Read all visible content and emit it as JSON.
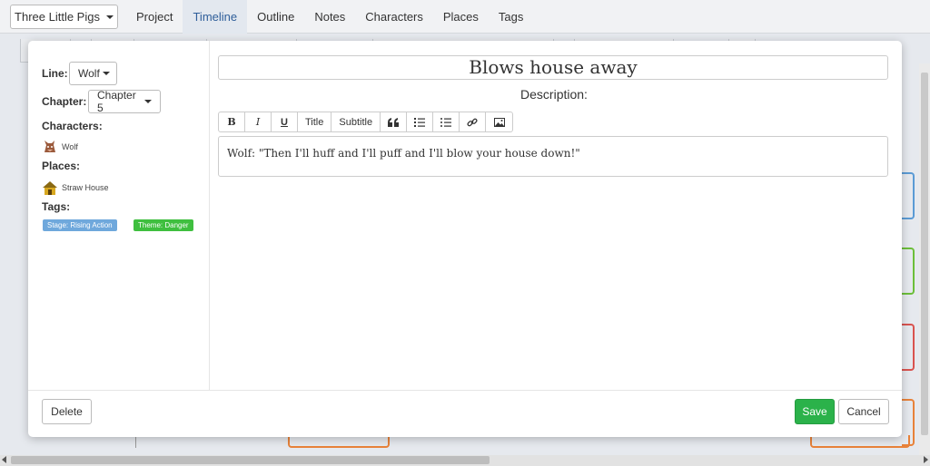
{
  "nav": {
    "project_dropdown": "Three Little Pigs",
    "tabs": [
      {
        "label": "Project"
      },
      {
        "label": "Timeline",
        "active": true
      },
      {
        "label": "Outline"
      },
      {
        "label": "Notes"
      },
      {
        "label": "Characters"
      },
      {
        "label": "Places"
      },
      {
        "label": "Tags"
      }
    ]
  },
  "modal": {
    "sidebar": {
      "line_label": "Line:",
      "line_value": "Wolf",
      "chapter_label": "Chapter:",
      "chapter_value": "Chapter 5",
      "characters_label": "Characters:",
      "characters": [
        {
          "name": "Wolf",
          "icon": "wolf-icon"
        }
      ],
      "places_label": "Places:",
      "places": [
        {
          "name": "Straw House",
          "icon": "straw-house-icon"
        }
      ],
      "tags_label": "Tags:",
      "tags": [
        {
          "label": "Stage: Rising Action",
          "color": "#6fa8dc"
        },
        {
          "label": "Theme: Danger",
          "color": "#3fbf3f"
        }
      ]
    },
    "title": "Blows house away",
    "description_label": "Description:",
    "toolbar": {
      "bold": "B",
      "italic": "I",
      "underline": "U",
      "title": "Title",
      "subtitle": "Subtitle"
    },
    "description": "Wolf: \"Then I'll huff and I'll puff and I'll blow your house down!\"",
    "buttons": {
      "delete": "Delete",
      "save": "Save",
      "cancel": "Cancel"
    }
  },
  "colors": {
    "accent": "#2f5e9a",
    "save": "#2bb24a",
    "bracket_blue": "#5b9bd5",
    "bracket_green": "#6cbf3a",
    "bracket_red": "#d9534f",
    "bracket_orange": "#e8823a"
  }
}
